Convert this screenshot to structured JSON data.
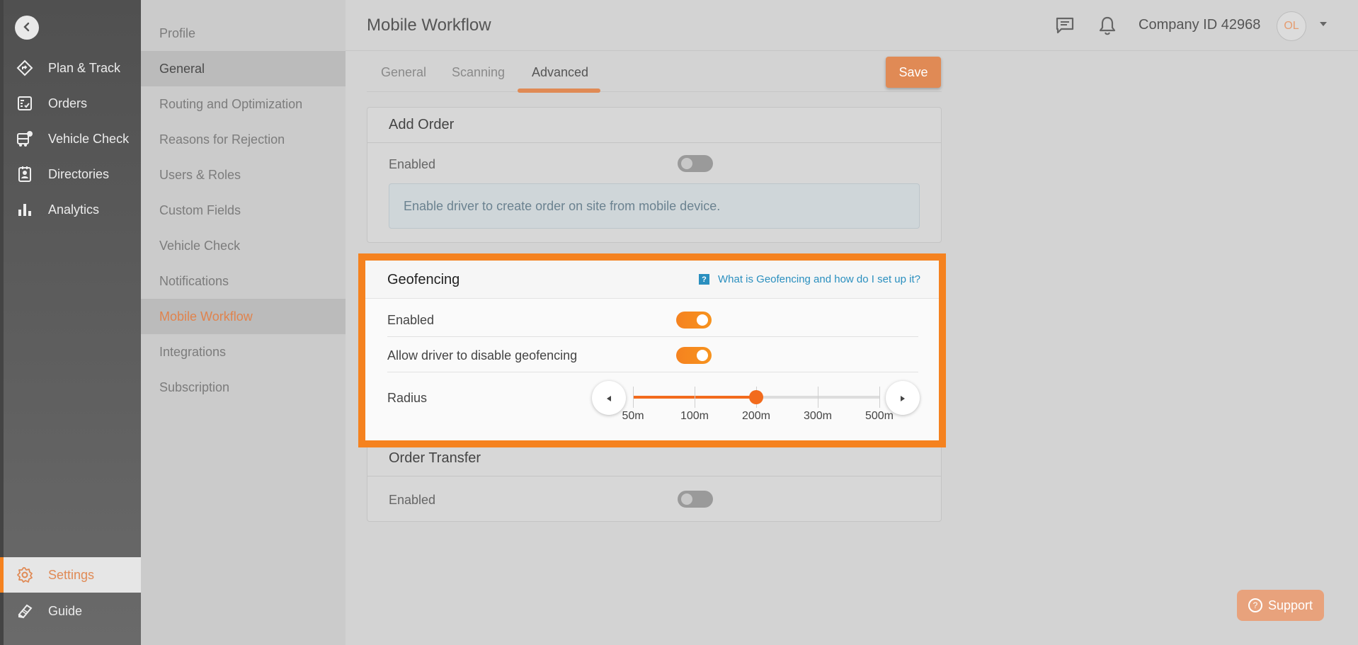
{
  "nav": {
    "back_icon": "chevron-left-icon",
    "items": [
      {
        "label": "Plan & Track",
        "icon": "route-icon"
      },
      {
        "label": "Orders",
        "icon": "orders-icon"
      },
      {
        "label": "Vehicle Check",
        "icon": "vehicle-check-icon"
      },
      {
        "label": "Directories",
        "icon": "directory-icon"
      },
      {
        "label": "Analytics",
        "icon": "bar-chart-icon"
      }
    ],
    "settings": {
      "label": "Settings",
      "icon": "gear-icon"
    },
    "guide": {
      "label": "Guide",
      "icon": "book-icon"
    }
  },
  "submenu": {
    "items": [
      "Profile",
      "General",
      "Routing and Optimization",
      "Reasons for Rejection",
      "Users & Roles",
      "Custom Fields",
      "Vehicle Check",
      "Notifications",
      "Mobile Workflow",
      "Integrations",
      "Subscription"
    ],
    "highlighted": "General",
    "selected": "Mobile Workflow"
  },
  "header": {
    "title": "Mobile Workflow",
    "company": "Company ID 42968",
    "avatar_initials": "OL",
    "chat_icon": "chat-icon",
    "bell_icon": "bell-icon"
  },
  "tabs": {
    "items": [
      "General",
      "Scanning",
      "Advanced"
    ],
    "active": "Advanced",
    "save_label": "Save"
  },
  "add_order": {
    "title": "Add Order",
    "enabled_label": "Enabled",
    "enabled": false,
    "info": "Enable driver to create order on site from mobile device."
  },
  "geofencing": {
    "title": "Geofencing",
    "help_link": "What is Geofencing and how do I set up it?",
    "help_icon": "?",
    "enabled_label": "Enabled",
    "enabled": true,
    "allow_disable_label": "Allow driver to disable geofencing",
    "allow_disable": true,
    "radius_label": "Radius",
    "radius_options": [
      "50m",
      "100m",
      "200m",
      "300m",
      "500m"
    ],
    "radius_value": "200m"
  },
  "order_transfer": {
    "title": "Order Transfer",
    "enabled_label": "Enabled",
    "enabled": false
  },
  "support": {
    "label": "Support",
    "icon": "?"
  },
  "colors": {
    "accent": "#f5821f",
    "link": "#2a8fbf"
  }
}
